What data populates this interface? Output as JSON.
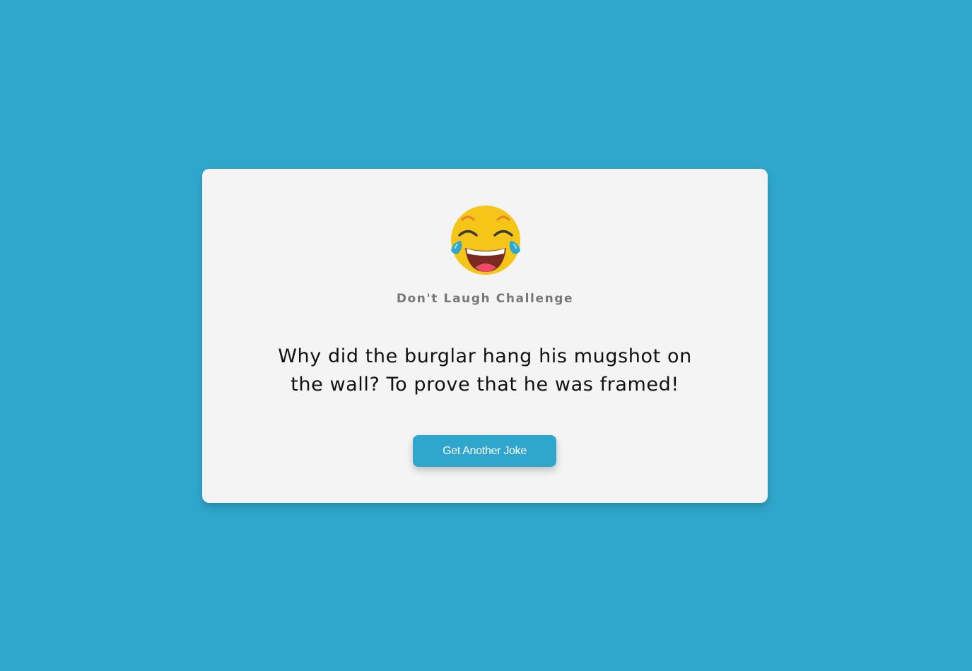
{
  "card": {
    "subtitle": "Don't Laugh Challenge",
    "joke": "Why did the burglar hang his mugshot on the wall? To prove that he was framed!",
    "button_label": "Get Another Joke",
    "emoji_icon": "face-with-tears-of-joy-icon"
  },
  "colors": {
    "background": "#2fa7cc",
    "card": "#f4f4f4",
    "accent": "#2fa7cc",
    "subtitle": "#777777",
    "joke_text": "#111111"
  }
}
